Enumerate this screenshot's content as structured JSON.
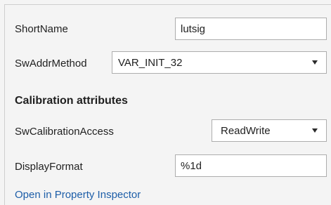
{
  "short_name": {
    "label": "ShortName",
    "value": "lutsig"
  },
  "sw_addr_method": {
    "label": "SwAddrMethod",
    "selected": "VAR_INIT_32"
  },
  "calibration_section": {
    "heading": "Calibration attributes"
  },
  "sw_calibration_access": {
    "label": "SwCalibrationAccess",
    "selected": "ReadWrite"
  },
  "display_format": {
    "label": "DisplayFormat",
    "value": "%1d"
  },
  "links": {
    "open_property_inspector": "Open in Property Inspector"
  },
  "icons": {
    "dropdown": "chevron-down-icon"
  },
  "colors": {
    "link": "#1d5ea8",
    "background": "#f4f4f4",
    "field_border": "#adadad"
  }
}
